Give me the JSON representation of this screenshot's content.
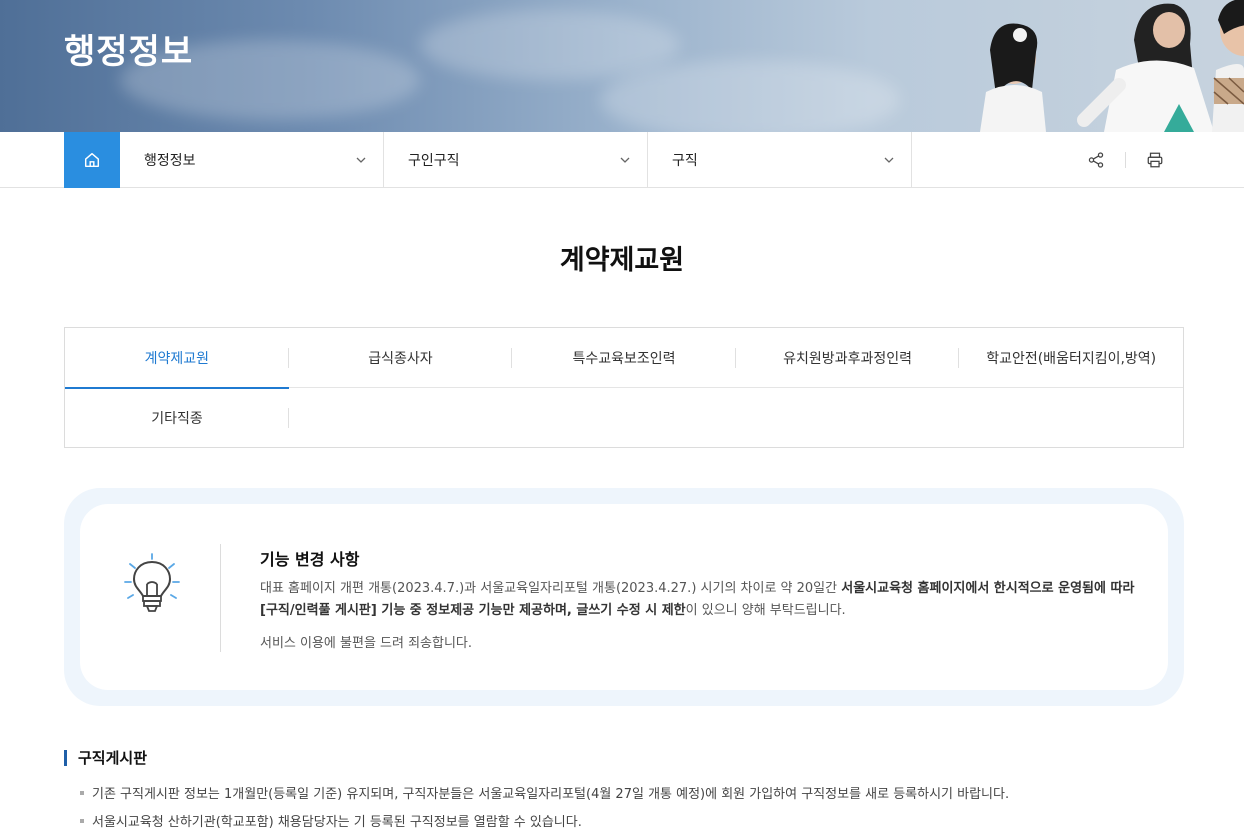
{
  "hero": {
    "title": "행정정보"
  },
  "breadcrumb": {
    "items": [
      {
        "label": "행정정보"
      },
      {
        "label": "구인구직"
      },
      {
        "label": "구직"
      }
    ]
  },
  "page": {
    "title": "계약제교원"
  },
  "tabs": {
    "row1": [
      "계약제교원",
      "급식종사자",
      "특수교육보조인력",
      "유치원방과후과정인력",
      "학교안전(배움터지킴이,방역)"
    ],
    "row2": [
      "기타직종"
    ],
    "active": "계약제교원"
  },
  "notice": {
    "title": "기능 변경 사항",
    "body_plain1": "대표 홈페이지 개편 개통(2023.4.7.)과 서울교육일자리포털 개통(2023.4.27.) 시기의 차이로 약 20일간 ",
    "body_bold": "서울시교육청 홈페이지에서 한시적으로 운영됨에 따라 [구직/인력풀 게시판] 기능 중 정보제공 기능만 제공하며, 글쓰기 수정 시 제한",
    "body_plain2": "이 있으니 양해 부탁드립니다.",
    "line2": "서비스 이용에 불편을 드려 죄송합니다."
  },
  "section": {
    "title": "구직게시판",
    "bullets": [
      "기존 구직게시판 정보는 1개월만(등록일 기준) 유지되며, 구직자분들은 서울교육일자리포털(4월 27일 개통 예정)에 회원 가입하여 구직정보를 새로 등록하시기 바랍니다.",
      "서울시교육청 산하기관(학교포함) 채용담당자는 기 등록된 구직정보를 열람할 수 있습니다."
    ]
  },
  "colors": {
    "accent": "#2a8ee0",
    "active_tab": "#1f7ad1",
    "notice_bg": "#eef5fc"
  },
  "icons": {
    "home": "home-icon",
    "share": "share-icon",
    "print": "print-icon",
    "chevron": "chevron-down-icon",
    "bulb": "lightbulb-icon"
  }
}
